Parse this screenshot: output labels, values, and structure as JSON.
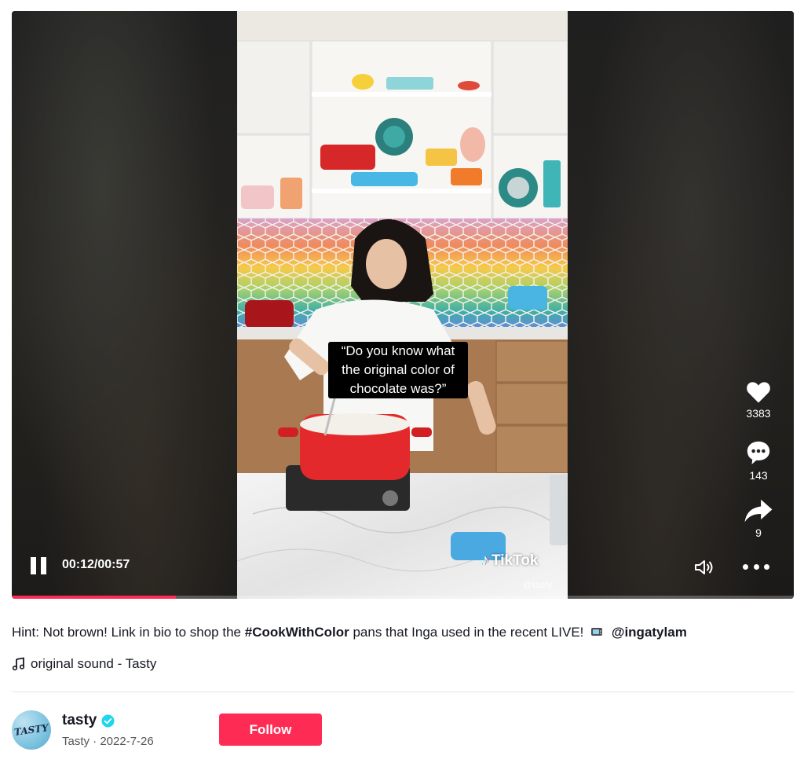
{
  "video": {
    "caption_lines": [
      "“Do you know what",
      "the original color of",
      "chocolate was?”"
    ],
    "watermark_brand": "TikTok",
    "watermark_handle": "@tasty",
    "time_display": "00:12/00:57",
    "progress": 0.21
  },
  "actions": {
    "likes": "3383",
    "comments": "143",
    "shares": "9"
  },
  "description": {
    "text_before": "Hint: Not brown! Link in bio to shop the ",
    "hashtag": "#CookWithColor",
    "text_after": " pans that Inga used in the recent LIVE!",
    "mention": "@ingatylam",
    "sound": "original sound - Tasty"
  },
  "author": {
    "username": "tasty",
    "avatar_text": "TASTY",
    "display_name_and_date": "Tasty · 2022-7-26",
    "follow_label": "Follow"
  },
  "colors": {
    "accent": "#fe2c55",
    "verified": "#20d5ec"
  }
}
